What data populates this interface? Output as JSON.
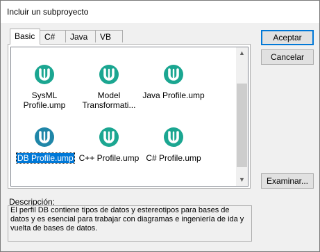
{
  "window": {
    "title": "Incluir un subproyecto"
  },
  "tabs": [
    {
      "label": "Basic",
      "active": true
    },
    {
      "label": "C#",
      "active": false
    },
    {
      "label": "Java",
      "active": false
    },
    {
      "label": "VB",
      "active": false
    }
  ],
  "items": [
    {
      "label": "SysML\nProfile.ump",
      "icon": "umodel-profile-icon",
      "selected": false
    },
    {
      "label": "Model\nTransformati...",
      "icon": "umodel-profile-icon",
      "selected": false
    },
    {
      "label": "Java Profile.ump",
      "icon": "umodel-profile-icon",
      "selected": false
    },
    {
      "label": "DB Profile.ump",
      "icon": "umodel-profile-icon",
      "selected": true
    },
    {
      "label": "C++ Profile.ump",
      "icon": "umodel-profile-icon",
      "selected": false
    },
    {
      "label": "C# Profile.ump",
      "icon": "umodel-profile-icon",
      "selected": false
    }
  ],
  "buttons": {
    "accept": "Aceptar",
    "cancel": "Cancelar",
    "browse": "Examinar..."
  },
  "description": {
    "label": "Descripción:",
    "text": "El perfil DB contiene tipos de datos y estereotipos para bases de datos y es esencial para trabajar con diagramas e ingeniería de ida y vuelta de bases de datos."
  },
  "colors": {
    "icon_teal": "#1ba691",
    "icon_selected": "#1f86a8",
    "selection": "#0078d7"
  }
}
